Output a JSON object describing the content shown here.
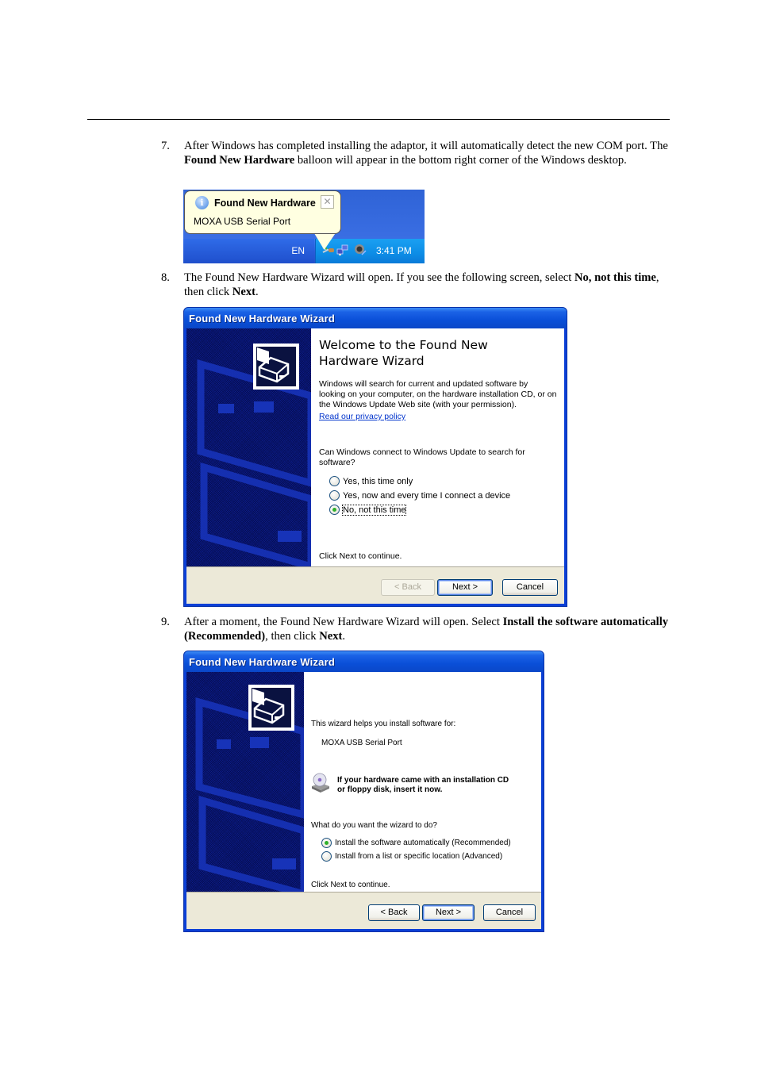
{
  "steps": [
    {
      "number": "7.",
      "parts": [
        {
          "t": "After Windows has completed installing the adaptor, it will automatically detect the new COM port. The ",
          "b": false
        },
        {
          "t": "Found New Hardware",
          "b": true
        },
        {
          "t": " balloon will appear in the bottom right corner of the Windows desktop.",
          "b": false
        }
      ]
    },
    {
      "number": "8.",
      "parts": [
        {
          "t": "The Found New Hardware Wizard will open. If you see the following screen, select ",
          "b": false
        },
        {
          "t": "No, not this time",
          "b": true
        },
        {
          "t": ", then click ",
          "b": false
        },
        {
          "t": "Next",
          "b": true
        },
        {
          "t": ".",
          "b": false
        }
      ]
    },
    {
      "number": "9.",
      "parts": [
        {
          "t": "After a moment, the Found New Hardware Wizard will open. Select ",
          "b": false
        },
        {
          "t": "Install the software automatically (Recommended)",
          "b": true
        },
        {
          "t": ", then click ",
          "b": false
        },
        {
          "t": "Next",
          "b": true
        },
        {
          "t": ".",
          "b": false
        }
      ]
    }
  ],
  "balloon": {
    "title": "Found New Hardware",
    "message": "MOXA USB Serial Port",
    "info_icon": "info-icon",
    "close_glyph": "✕"
  },
  "taskbar": {
    "language": "EN",
    "clock": "3:41 PM",
    "tray_icons": [
      "usb-device-icon",
      "network-icon",
      "volume-icon"
    ]
  },
  "wizard1": {
    "title": "Found New Hardware Wizard",
    "heading_line1": "Welcome to the Found New",
    "heading_line2": "Hardware Wizard",
    "intro_lines": [
      "Windows will search for current and updated software by",
      "looking on your computer, on the hardware installation CD, or on",
      "the Windows Update Web site (with your permission)."
    ],
    "privacy_link": "Read our privacy policy",
    "question_lines": [
      "Can Windows connect to Windows Update to search for",
      "software?"
    ],
    "options": [
      {
        "label": "Yes, this time only",
        "selected": false
      },
      {
        "label": "Yes, now and every time I connect a device",
        "selected": false
      },
      {
        "label": "No, not this time",
        "selected": true
      }
    ],
    "footer_text": "Click Next to continue.",
    "buttons": {
      "back": "< Back",
      "next": "Next >",
      "cancel": "Cancel"
    }
  },
  "wizard2": {
    "title": "Found New Hardware Wizard",
    "intro": "This wizard helps you install software for:",
    "device": "MOXA USB Serial Port",
    "cd_notice_line1": "If your hardware came with an installation CD",
    "cd_notice_line2": "or floppy disk, insert it now.",
    "question": "What do you want the wizard to do?",
    "options": [
      {
        "label": "Install the software automatically (Recommended)",
        "selected": true
      },
      {
        "label": "Install from a list or specific location (Advanced)",
        "selected": false
      }
    ],
    "footer_text": "Click Next to continue.",
    "buttons": {
      "back": "< Back",
      "next": "Next >",
      "cancel": "Cancel"
    }
  }
}
